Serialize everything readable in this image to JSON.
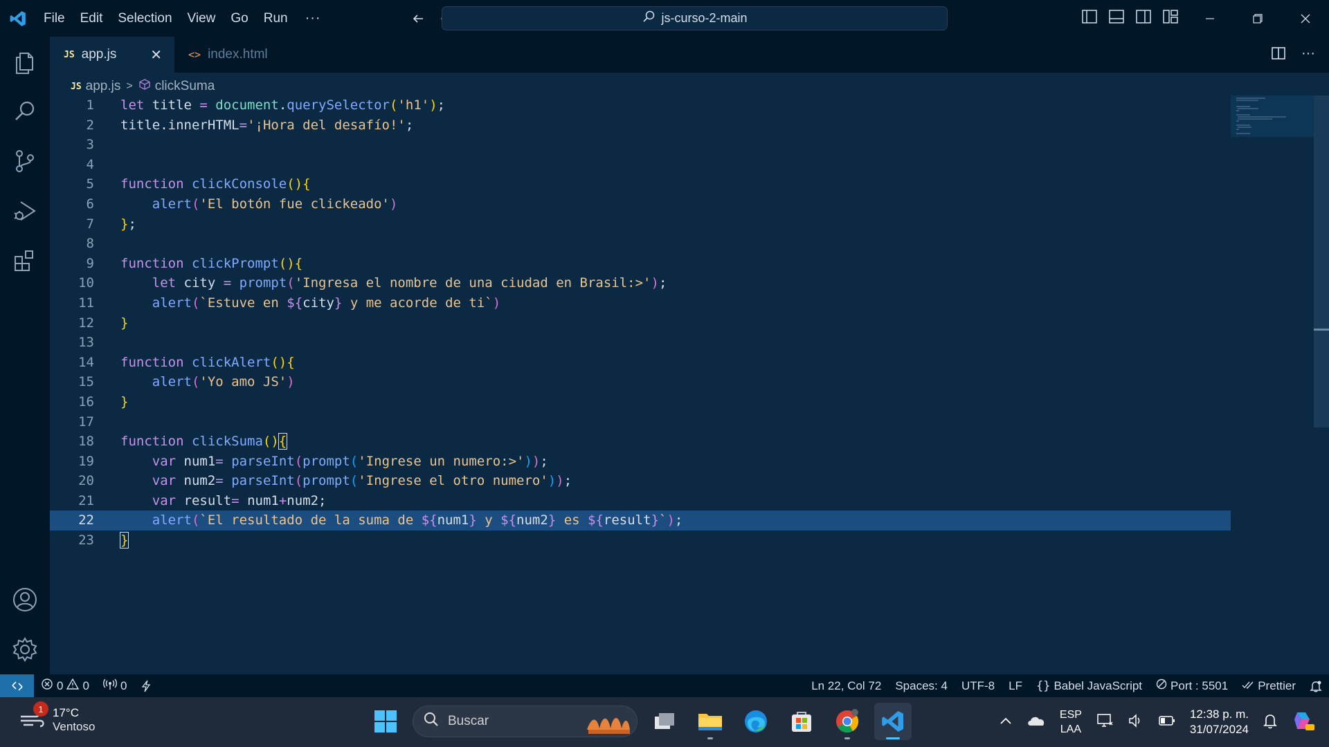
{
  "titlebar": {
    "menus": [
      "File",
      "Edit",
      "Selection",
      "View",
      "Go",
      "Run"
    ],
    "more": "···",
    "search": "js-curso-2-main"
  },
  "tabs": [
    {
      "badge": "JS",
      "label": "app.js",
      "close": "✕"
    },
    {
      "badge": "<>",
      "label": "index.html"
    }
  ],
  "breadcrumb": {
    "badge": "JS",
    "file": "app.js",
    "symbol": "clickSuma"
  },
  "lines": [
    "1",
    "2",
    "3",
    "4",
    "5",
    "6",
    "7",
    "8",
    "9",
    "10",
    "11",
    "12",
    "13",
    "14",
    "15",
    "16",
    "17",
    "18",
    "19",
    "20",
    "21",
    "22",
    "23"
  ],
  "code": {
    "l1": {
      "let": "let",
      "title": " title ",
      "eq": "= ",
      "doc": "document",
      "dot": ".",
      "qs": "querySelector",
      "p1": "(",
      "s": "'h1'",
      "p2": ")",
      "semi": ";"
    },
    "l2": {
      "title": "title",
      "dot": ".",
      "prop": "innerHTML",
      "eq": "=",
      "s": "'¡Hora del desafío!'",
      "semi": ";"
    },
    "l5": {
      "kw": "function",
      "name": " clickConsole",
      "p": "()",
      "b": "{"
    },
    "l6": {
      "fn": "alert",
      "p1": "(",
      "s": "'El botón fue clickeado'",
      "p2": ")"
    },
    "l7": {
      "b": "}",
      "semi": ";"
    },
    "l9": {
      "kw": "function",
      "name": " clickPrompt",
      "p": "()",
      "b": "{"
    },
    "l10": {
      "kw": "let",
      "v": " city ",
      "eq": "= ",
      "fn": "prompt",
      "p1": "(",
      "s": "'Ingresa el nombre de una ciudad en Brasil:>'",
      "p2": ")",
      "semi": ";"
    },
    "l11": {
      "fn": "alert",
      "p1": "(",
      "s1": "`Estuve en ",
      "i1": "${",
      "iv": "city",
      "i2": "}",
      "s2": " y me acorde de ti`",
      "p2": ")"
    },
    "l12": {
      "b": "}"
    },
    "l14": {
      "kw": "function",
      "name": " clickAlert",
      "p": "()",
      "b": "{"
    },
    "l15": {
      "fn": "alert",
      "p1": "(",
      "s": "'Yo amo JS'",
      "p2": ")"
    },
    "l16": {
      "b": "}"
    },
    "l18": {
      "kw": "function",
      "name": " clickSuma",
      "p": "()",
      "b": "{"
    },
    "l19": {
      "kw": "var",
      "v": " num1",
      "eq": "= ",
      "fn": "parseInt",
      "p1": "(",
      "fn2": "prompt",
      "p3": "(",
      "s": "'Ingrese un numero:>'",
      "p4": ")",
      "p2": ")",
      "semi": ";"
    },
    "l20": {
      "kw": "var",
      "v": " num2",
      "eq": "= ",
      "fn": "parseInt",
      "p1": "(",
      "fn2": "prompt",
      "p3": "(",
      "s": "'Ingrese el otro numero'",
      "p4": ")",
      "p2": ")",
      "semi": ";"
    },
    "l21": {
      "kw": "var",
      "v": " result",
      "eq": "= ",
      "a": "num1",
      "plus": "+",
      "b": "num2",
      "semi": ";"
    },
    "l22": {
      "fn": "alert",
      "p1": "(",
      "s1": "`El resultado de la suma de ",
      "i1a": "${",
      "iv1": "num1",
      "i1b": "}",
      "s2": " y ",
      "i2a": "${",
      "iv2": "num2",
      "i2b": "}",
      "s3": " es ",
      "i3a": "${",
      "iv3": "result",
      "i3b": "}",
      "s4": "`",
      "p2": ")",
      "semi": ";"
    },
    "l23": {
      "b": "}"
    }
  },
  "statusbar": {
    "errors": "0",
    "warnings": "0",
    "ports": "0",
    "position": "Ln 22, Col 72",
    "spaces": "Spaces: 4",
    "encoding": "UTF-8",
    "eol": "LF",
    "language": "Babel JavaScript",
    "port": "Port : 5501",
    "prettier": "Prettier"
  },
  "taskbar": {
    "weather_temp": "17°C",
    "weather_desc": "Ventoso",
    "weather_badge": "1",
    "search_placeholder": "Buscar",
    "lang1": "ESP",
    "lang2": "LAA",
    "time": "12:38 p. m.",
    "date": "31/07/2024"
  },
  "colors": {
    "bg": "#011627",
    "editor": "#0b2942",
    "current_line": "#1c4d80",
    "accent": "#1c6fa8"
  }
}
